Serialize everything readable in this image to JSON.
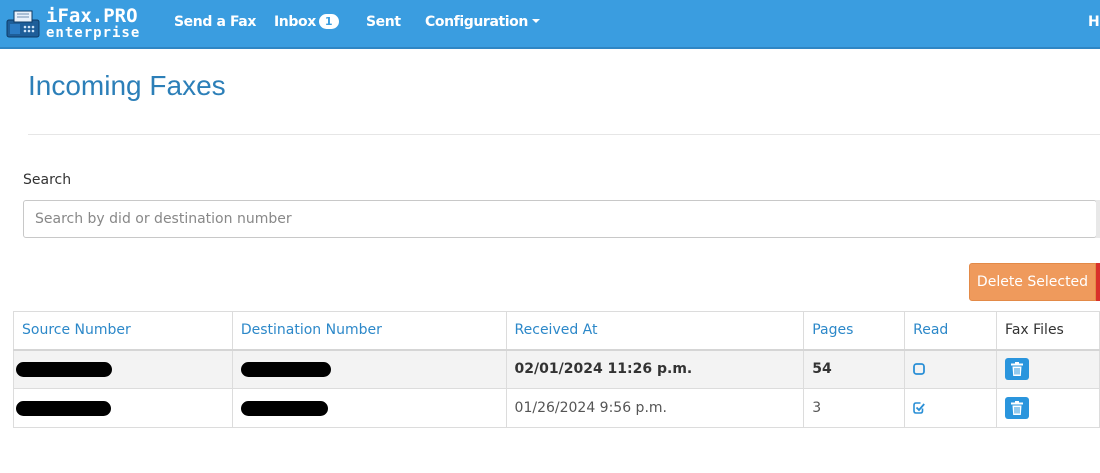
{
  "brand": {
    "title": "iFax.PRO",
    "subtitle": "enterprise",
    "logo_icon": "fax-machine-icon"
  },
  "nav": {
    "send_fax": "Send a Fax",
    "inbox": "Inbox",
    "inbox_count": "1",
    "sent": "Sent",
    "configuration": "Configuration",
    "right_partial": "H"
  },
  "page": {
    "title": "Incoming Faxes"
  },
  "search": {
    "label": "Search",
    "placeholder": "Search by did or destination number",
    "value": ""
  },
  "actions": {
    "delete_selected": "Delete Selected"
  },
  "table": {
    "headers": [
      "Source Number",
      "Destination Number",
      "Received At",
      "Pages",
      "Read",
      "Fax Files"
    ],
    "rows": [
      {
        "source": "",
        "destination": "",
        "received_at": "02/01/2024 11:26 p.m.",
        "pages": "54",
        "read": false,
        "file_icon": "trash-icon"
      },
      {
        "source": "",
        "destination": "",
        "received_at": "01/26/2024 9:56 p.m.",
        "pages": "3",
        "read": true,
        "file_icon": "trash-icon"
      }
    ]
  },
  "colors": {
    "navbar": "#3a9de0",
    "title": "#2c7fb8",
    "link": "#2c88c9",
    "delete_button": "#ef9a5c",
    "danger_edge": "#d9302a",
    "icon_button": "#2a95dd"
  }
}
